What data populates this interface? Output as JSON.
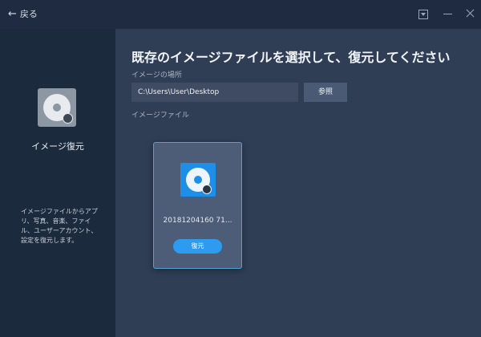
{
  "titlebar": {
    "back_label": "戻る"
  },
  "sidebar": {
    "title": "イメージ復元",
    "description": "イメージファイルからアプリ、写真、音楽、ファイル、ユーザーアカウント、設定を復元します。"
  },
  "main": {
    "heading": "既存のイメージファイルを選択して、復元してください",
    "location_label": "イメージの場所",
    "path_value": "C:\\Users\\User\\Desktop",
    "browse_label": "参照",
    "file_label": "イメージファイル",
    "image_card": {
      "filename": "20181204160 71...",
      "restore_label": "復元"
    }
  }
}
